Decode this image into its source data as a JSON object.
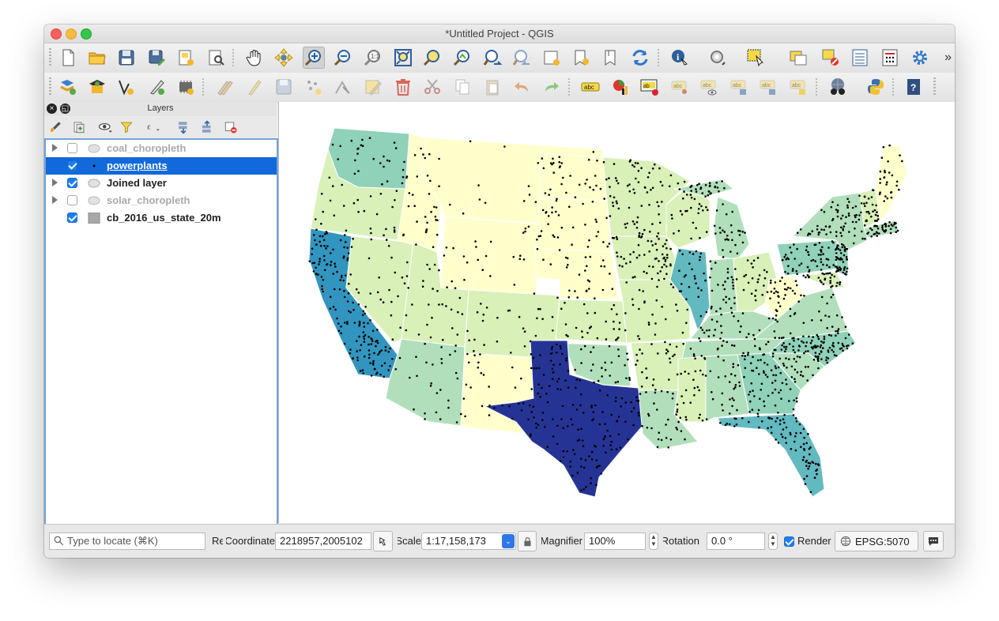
{
  "window": {
    "title": "*Untitled Project - QGIS"
  },
  "toolbar1": [
    "new-project",
    "open-project",
    "save-project",
    "save-as",
    "new-print-layout",
    "layout-manager",
    "pan",
    "pan-to-selection",
    "zoom-in",
    "zoom-out",
    "zoom-native",
    "zoom-full",
    "zoom-to-selection",
    "zoom-to-layer",
    "zoom-last",
    "zoom-next",
    "new-map-view",
    "new-bookmark",
    "show-bookmarks",
    "refresh",
    "identify",
    "run-action",
    "select-features",
    "open-attribute-table",
    "deselect-all",
    "field-calculator",
    "statistics",
    "settings"
  ],
  "toolbar2": [
    "add-vector-layer",
    "add-raster-layer",
    "digitize-line",
    "digitize-polygon",
    "toggle-editing",
    "pencil",
    "save-edits",
    "add-feature",
    "vertex-tool",
    "modify-attributes",
    "delete-selected",
    "cut",
    "copy",
    "paste",
    "undo",
    "redo",
    "label-tool",
    "diagram-tool",
    "pin-labels",
    "highlight-labels",
    "show-hide-labels",
    "move-label",
    "rotate-label",
    "change-label",
    "plugins-globe",
    "python-console",
    "help"
  ],
  "layers": {
    "title": "Layers",
    "items": [
      {
        "name": "coal_choropleth",
        "checked": false,
        "visible_style": "dim",
        "expandable": true,
        "icon": "polygon-icon"
      },
      {
        "name": "powerplants",
        "checked": true,
        "visible_style": "selected",
        "expandable": false,
        "icon": "point-icon"
      },
      {
        "name": "Joined layer",
        "checked": true,
        "visible_style": "normal",
        "expandable": true,
        "icon": "polygon-icon"
      },
      {
        "name": "solar_choropleth",
        "checked": false,
        "visible_style": "dim",
        "expandable": true,
        "icon": "polygon-icon"
      },
      {
        "name": "cb_2016_us_state_20m",
        "checked": true,
        "visible_style": "normal",
        "expandable": false,
        "icon": "fill-swatch-icon"
      }
    ]
  },
  "map": {
    "colors": {
      "lowest": "#ffffcc",
      "low": "#d9f0b8",
      "mid": "#b2dfbb",
      "midhigh": "#8fd1b9",
      "high": "#63b9c0",
      "higher": "#3295bf",
      "highest": "#253494",
      "points": "#000000"
    }
  },
  "status": {
    "locate_placeholder": "Type to locate (⌘K)",
    "render_short": "Re",
    "coordinate_label": "Coordinate",
    "coordinate_value": "2218957,2005102",
    "scale_label": "Scale",
    "scale_value": "1:17,158,173",
    "magnifier_label": "Magnifier",
    "magnifier_value": "100%",
    "rotation_label": "Rotation",
    "rotation_value": "0.0 °",
    "render_label": "Render",
    "crs": "EPSG:5070"
  }
}
